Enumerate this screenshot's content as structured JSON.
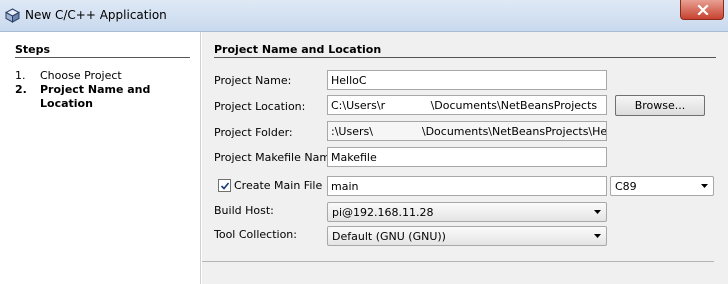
{
  "window": {
    "title": "New C/C++ Application"
  },
  "steps": {
    "title": "Steps",
    "items": [
      {
        "num": "1.",
        "label": "Choose Project"
      },
      {
        "num": "2.",
        "label": "Project Name and Location"
      }
    ]
  },
  "form": {
    "section_title": "Project Name and Location",
    "project_name": {
      "label": "Project Name:",
      "value": "HelloC"
    },
    "project_location": {
      "label": "Project Location:",
      "value": "C:\\Users\\r             \\Documents\\NetBeansProjects",
      "browse_label": "Browse..."
    },
    "project_folder": {
      "label": "Project Folder:",
      "value": ":\\Users\\              \\Documents\\NetBeansProjects\\HelloC"
    },
    "makefile_name": {
      "label": "Project Makefile Name:",
      "value": "Makefile"
    },
    "create_main_file": {
      "label": "Create Main File",
      "checked": true,
      "value": "main",
      "standard": "C89"
    },
    "build_host": {
      "label": "Build Host:",
      "value": "pi@192.168.11.28"
    },
    "tool_collection": {
      "label": "Tool Collection:",
      "value": "Default (GNU (GNU))"
    }
  },
  "icons": {
    "app": "netbeans-cube-icon",
    "close": "close-icon",
    "dropdown": "chevron-down-icon",
    "check": "checkmark-icon"
  },
  "colors": {
    "close_button": "#c7432f",
    "titlebar": "#dfe9f5",
    "panel_bg": "#f0f0f0"
  }
}
